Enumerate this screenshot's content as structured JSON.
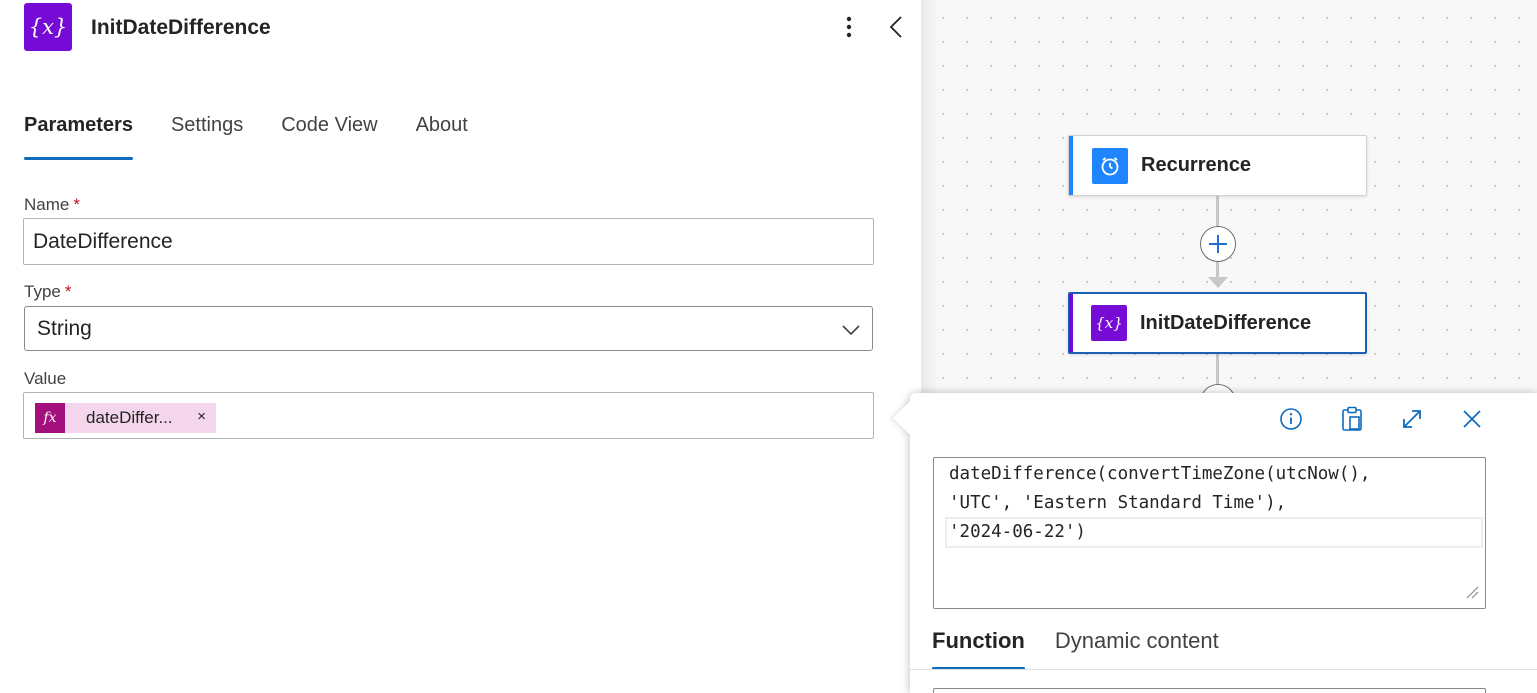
{
  "panel": {
    "title": "InitDateDifference",
    "header_icon": "variable-icon",
    "more_icon": "more-vertical-icon",
    "collapse_icon": "chevron-left-icon",
    "tabs": [
      {
        "label": "Parameters",
        "active": true
      },
      {
        "label": "Settings",
        "active": false
      },
      {
        "label": "Code View",
        "active": false
      },
      {
        "label": "About",
        "active": false
      }
    ],
    "fields": {
      "name": {
        "label": "Name",
        "required_mark": "*",
        "value": "DateDifference"
      },
      "type": {
        "label": "Type",
        "required_mark": "*",
        "value": "String"
      },
      "value": {
        "label": "Value",
        "token": {
          "icon_text": "fx",
          "text": "dateDiffer...",
          "remove_label": "×"
        }
      }
    }
  },
  "canvas": {
    "nodes": [
      {
        "label": "Recurrence",
        "icon": "clock-icon",
        "accent": "#1f85ff"
      },
      {
        "label": "InitDateDifference",
        "icon": "variable-icon",
        "accent": "#770bd6",
        "selected": true
      }
    ],
    "add_button_icon": "plus-icon"
  },
  "expression_popup": {
    "toolbar_icons": [
      "info-icon",
      "clipboard-icon",
      "expand-icon",
      "close-icon"
    ],
    "expression_lines": [
      "dateDifference(convertTimeZone(utcNow(),",
      "'UTC', 'Eastern Standard Time'),",
      "'2024-06-22')"
    ],
    "tabs": [
      {
        "label": "Function",
        "active": true
      },
      {
        "label": "Dynamic content",
        "active": false
      }
    ]
  },
  "colors": {
    "brand_purple": "#770bd6",
    "recurrence_blue": "#1f85ff",
    "tab_underline": "#0f6cbd",
    "required_red": "#c50f1f",
    "token_bg": "#f3d6ec",
    "token_icon_bg": "#a3107e"
  }
}
